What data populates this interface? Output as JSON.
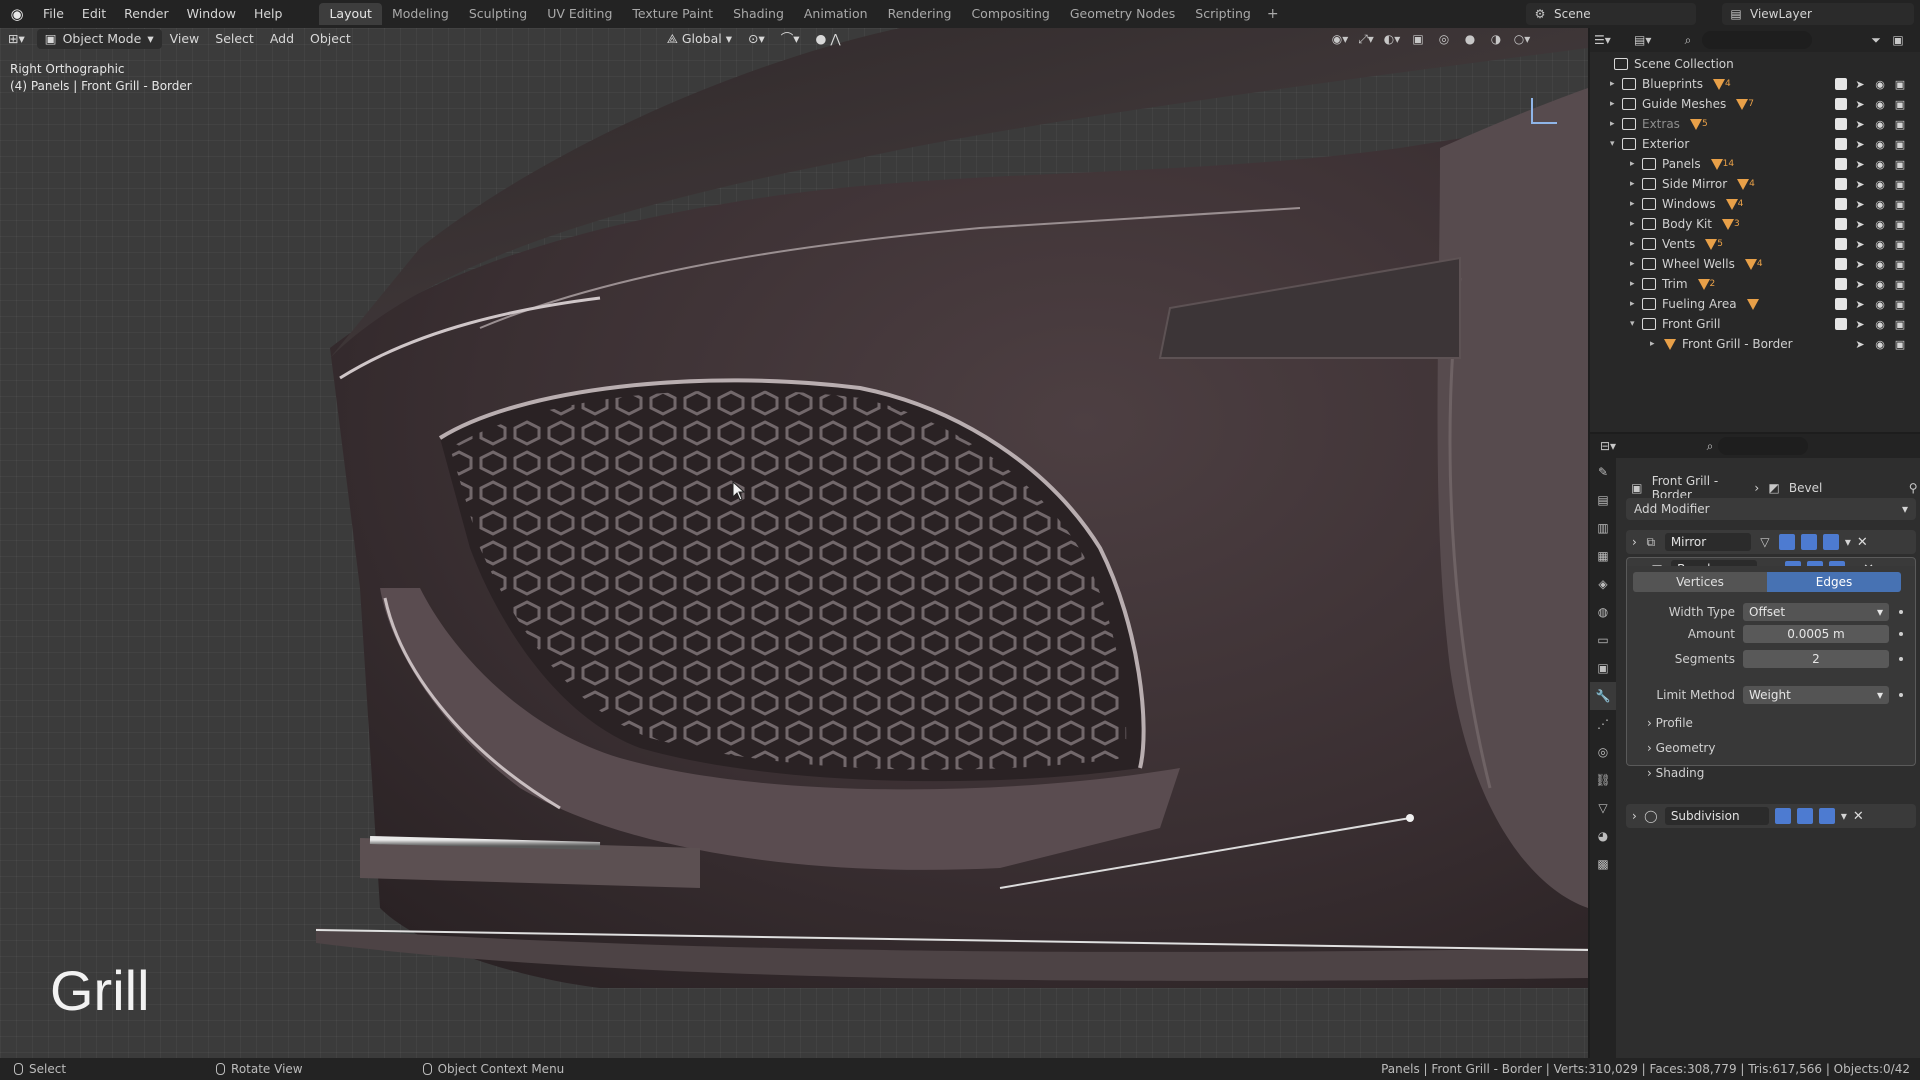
{
  "menus": [
    "File",
    "Edit",
    "Render",
    "Window",
    "Help"
  ],
  "workspaces": [
    "Layout",
    "Modeling",
    "Sculpting",
    "UV Editing",
    "Texture Paint",
    "Shading",
    "Animation",
    "Rendering",
    "Compositing",
    "Geometry Nodes",
    "Scripting"
  ],
  "active_workspace": "Layout",
  "scene_name": "Scene",
  "view_layer": "ViewLayer",
  "viewport": {
    "mode": "Object Mode",
    "menus": [
      "View",
      "Select",
      "Add",
      "Object"
    ],
    "transform_orientation": "Global",
    "view_name": "Right Orthographic",
    "context_line": "(4) Panels | Front Grill - Border",
    "caption": "Grill"
  },
  "outliner": {
    "root": "Scene Collection",
    "rows": [
      {
        "label": "Blueprints",
        "count": "4",
        "level": 1
      },
      {
        "label": "Guide Meshes",
        "count": "7",
        "level": 1
      },
      {
        "label": "Extras",
        "count": "5",
        "level": 1
      },
      {
        "label": "Exterior",
        "count": "",
        "level": 1
      },
      {
        "label": "Panels",
        "count": "14",
        "level": 2
      },
      {
        "label": "Side Mirror",
        "count": "4",
        "level": 2
      },
      {
        "label": "Windows",
        "count": "4",
        "level": 2
      },
      {
        "label": "Body Kit",
        "count": "3",
        "level": 2
      },
      {
        "label": "Vents",
        "count": "5",
        "level": 2
      },
      {
        "label": "Wheel Wells",
        "count": "4",
        "level": 2
      },
      {
        "label": "Trim",
        "count": "2",
        "level": 2
      },
      {
        "label": "Fueling Area",
        "count": "",
        "level": 2
      },
      {
        "label": "Front Grill",
        "count": "",
        "level": 2
      },
      {
        "label": "Front Grill - Border",
        "count": "",
        "level": 3
      }
    ]
  },
  "properties": {
    "object_name": "Front Grill - Border",
    "modifier_context": "Bevel",
    "add_modifier": "Add Modifier",
    "modifiers": [
      {
        "name": "Mirror"
      },
      {
        "name": "Bevel"
      },
      {
        "name": "Subdivision"
      }
    ],
    "bevel": {
      "affect_vertices": "Vertices",
      "affect_edges": "Edges",
      "width_type_label": "Width Type",
      "width_type": "Offset",
      "amount_label": "Amount",
      "amount": "0.0005 m",
      "segments_label": "Segments",
      "segments": "2",
      "limit_method_label": "Limit Method",
      "limit_method": "Weight",
      "sections": [
        "Profile",
        "Geometry",
        "Shading"
      ]
    }
  },
  "statusbar": {
    "select": "Select",
    "rotate": "Rotate View",
    "context_menu": "Object Context Menu",
    "stats": "Panels | Front Grill - Border | Verts:310,029 | Faces:308,779 | Tris:617,566 | Objects:0/42"
  },
  "colors": {
    "selected_blue": "#4772b3",
    "mesh_orange": "#e8a048",
    "body_paint": "#4a3a3d"
  }
}
